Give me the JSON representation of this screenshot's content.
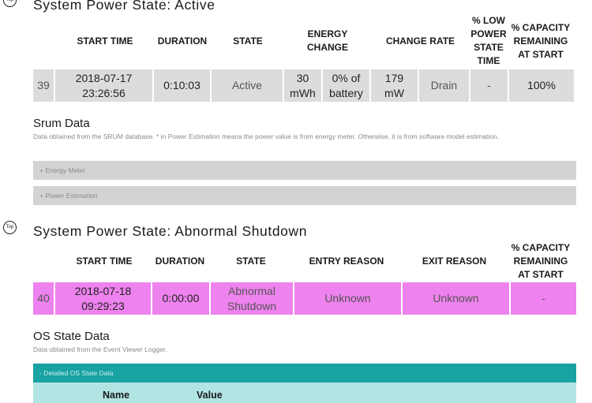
{
  "top_icon_label": "Top",
  "active_section": {
    "title": "System Power State: Active",
    "headers": {
      "start_time": "START TIME",
      "duration": "DURATION",
      "state": "STATE",
      "energy_change": "ENERGY CHANGE",
      "change_rate": "CHANGE RATE",
      "low_power": "% LOW POWER STATE TIME",
      "capacity": "% CAPACITY REMAINING AT START"
    },
    "row": {
      "index": "39",
      "start_time": "2018-07-17 23:26:56",
      "duration": "0:10:03",
      "state": "Active",
      "energy_mwh": "30 mWh",
      "energy_pct": "0% of battery",
      "rate": "179 mW",
      "rate_type": "Drain",
      "low_power": "-",
      "capacity": "100%"
    },
    "row_color": "#dcdcdc"
  },
  "srum": {
    "title": "Srum Data",
    "description": "Data obtained from the SRUM database. * in Power Estimation means the power value is from energy meter. Otherwise, it is from software model estimation.",
    "accordions": [
      {
        "label": "+ Energy Meter"
      },
      {
        "label": "+ Power Estimation"
      }
    ]
  },
  "abnormal_section": {
    "title": "System Power State: Abnormal Shutdown",
    "headers": {
      "start_time": "START TIME",
      "duration": "DURATION",
      "state": "STATE",
      "entry_reason": "ENTRY REASON",
      "exit_reason": "EXIT REASON",
      "capacity": "% CAPACITY REMAINING AT START"
    },
    "row": {
      "index": "40",
      "start_time": "2018-07-18 09:29:23",
      "duration": "0:00:00",
      "state": "Abnormal Shutdown",
      "entry_reason": "Unknown",
      "exit_reason": "Unknown",
      "capacity": "-"
    },
    "row_color": "#ee82ee"
  },
  "os_state": {
    "title": "OS State Data",
    "description": "Data obtained from the Event Viewer Logger.",
    "accordion_label": "- Detailed OS State Data",
    "columns": [
      "Name",
      "Value"
    ],
    "accordion_color": "#18a2a2",
    "table_header_color": "#b2e4e4"
  }
}
